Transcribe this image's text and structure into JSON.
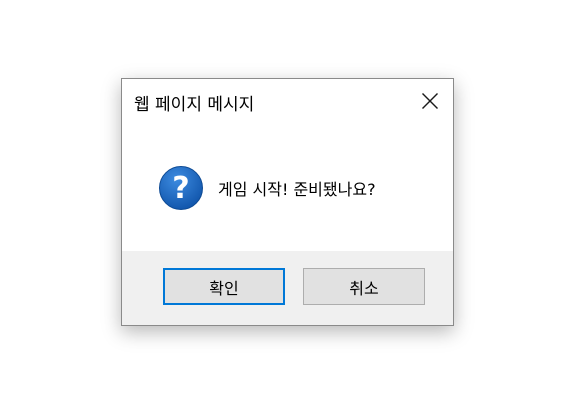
{
  "window": {
    "title": "웹 페이지 메시지",
    "close_icon": "close-icon"
  },
  "content": {
    "icon": "question-icon",
    "icon_color": "#1a63b8",
    "message": "게임 시작! 준비됐나요?"
  },
  "buttons": {
    "ok_label": "확인",
    "cancel_label": "취소",
    "focus_color": "#0078d7"
  }
}
